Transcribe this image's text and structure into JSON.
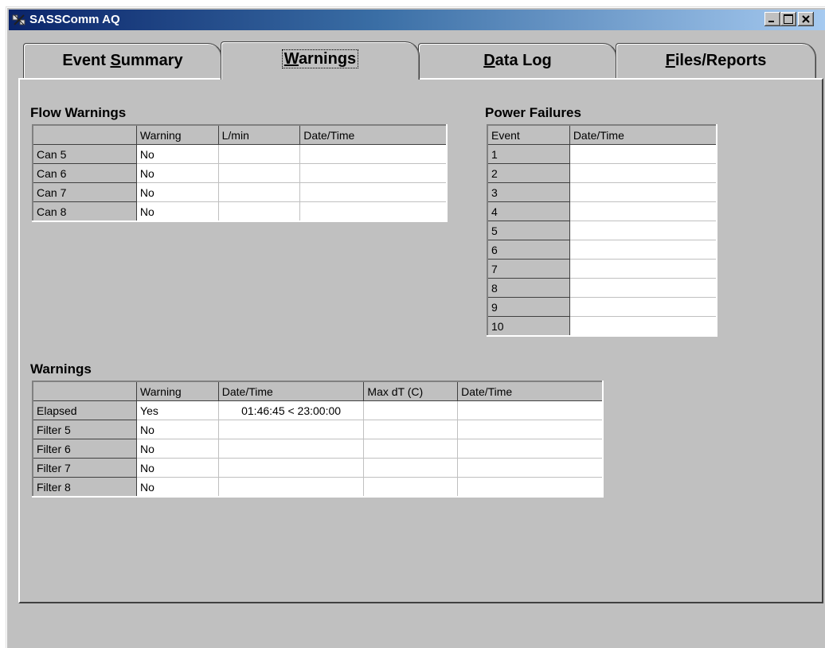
{
  "window": {
    "title": "SASSComm AQ"
  },
  "tabs": [
    {
      "label_pre": "Event ",
      "label_u": "S",
      "label_post": "ummary"
    },
    {
      "label_pre": "",
      "label_u": "W",
      "label_post": "arnings"
    },
    {
      "label_pre": "",
      "label_u": "D",
      "label_post": "ata Log"
    },
    {
      "label_pre": "",
      "label_u": "F",
      "label_post": "iles/Reports"
    }
  ],
  "flow_warnings": {
    "title": "Flow Warnings",
    "columns": [
      "",
      "Warning",
      "L/min",
      "Date/Time"
    ],
    "rows": [
      {
        "name": "Can 5",
        "warning": "No",
        "lmin": "",
        "datetime": ""
      },
      {
        "name": "Can 6",
        "warning": "No",
        "lmin": "",
        "datetime": ""
      },
      {
        "name": "Can 7",
        "warning": "No",
        "lmin": "",
        "datetime": ""
      },
      {
        "name": "Can 8",
        "warning": "No",
        "lmin": "",
        "datetime": ""
      }
    ]
  },
  "power_failures": {
    "title": "Power Failures",
    "columns": [
      "Event",
      "Date/Time"
    ],
    "rows": [
      {
        "event": "1",
        "datetime": ""
      },
      {
        "event": "2",
        "datetime": ""
      },
      {
        "event": "3",
        "datetime": ""
      },
      {
        "event": "4",
        "datetime": ""
      },
      {
        "event": "5",
        "datetime": ""
      },
      {
        "event": "6",
        "datetime": ""
      },
      {
        "event": "7",
        "datetime": ""
      },
      {
        "event": "8",
        "datetime": ""
      },
      {
        "event": "9",
        "datetime": ""
      },
      {
        "event": "10",
        "datetime": ""
      }
    ]
  },
  "warnings": {
    "title": "Warnings",
    "columns": [
      "",
      "Warning",
      "Date/Time",
      "Max dT (C)",
      "Date/Time"
    ],
    "rows": [
      {
        "name": "Elapsed",
        "warning": "Yes",
        "datetime": "01:46:45 < 23:00:00",
        "maxdt": "",
        "datetime2": ""
      },
      {
        "name": "Filter 5",
        "warning": "No",
        "datetime": "",
        "maxdt": "",
        "datetime2": ""
      },
      {
        "name": "Filter 6",
        "warning": "No",
        "datetime": "",
        "maxdt": "",
        "datetime2": ""
      },
      {
        "name": "Filter 7",
        "warning": "No",
        "datetime": "",
        "maxdt": "",
        "datetime2": ""
      },
      {
        "name": "Filter 8",
        "warning": "No",
        "datetime": "",
        "maxdt": "",
        "datetime2": ""
      }
    ]
  }
}
